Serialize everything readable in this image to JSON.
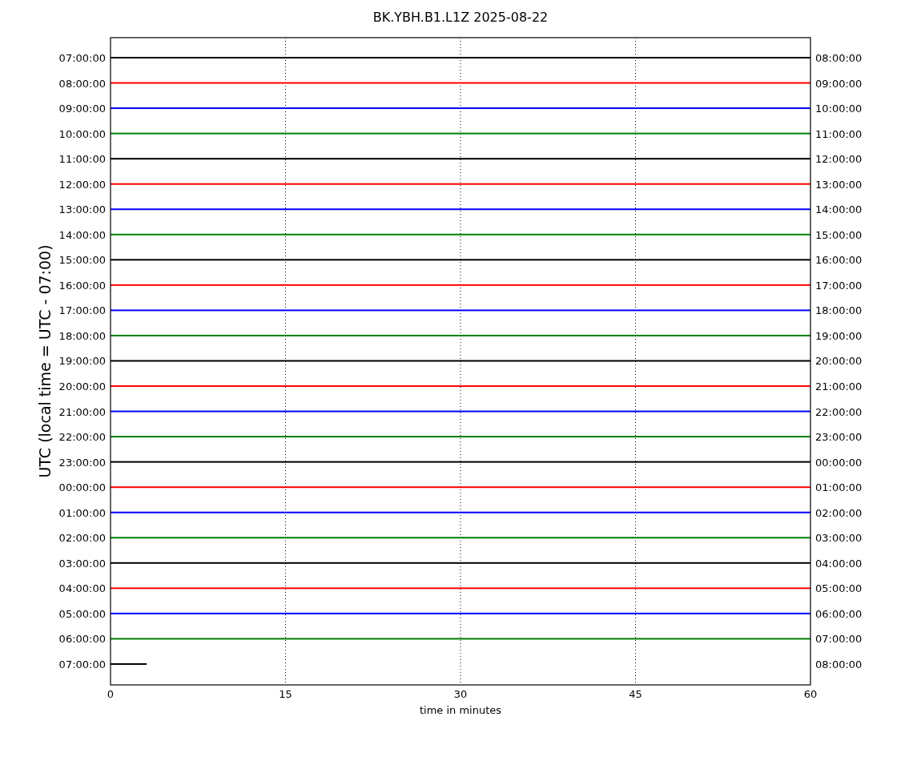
{
  "title": "BK.YBH.B1.L1Z 2025-08-22",
  "y_axis": {
    "label": "UTC (local time = UTC - 07:00)"
  },
  "x_axis": {
    "label": "time in minutes",
    "ticks": [
      "0",
      "15",
      "30",
      "45",
      "60"
    ]
  },
  "traces": [
    {
      "left": "07:00:00",
      "right": "08:00:00",
      "color": "#000000",
      "kind": "full"
    },
    {
      "left": "08:00:00",
      "right": "09:00:00",
      "color": "#ff0000",
      "kind": "full"
    },
    {
      "left": "09:00:00",
      "right": "10:00:00",
      "color": "#0000ff",
      "kind": "full"
    },
    {
      "left": "10:00:00",
      "right": "11:00:00",
      "color": "#008000",
      "kind": "full"
    },
    {
      "left": "11:00:00",
      "right": "12:00:00",
      "color": "#000000",
      "kind": "full"
    },
    {
      "left": "12:00:00",
      "right": "13:00:00",
      "color": "#ff0000",
      "kind": "full"
    },
    {
      "left": "13:00:00",
      "right": "14:00:00",
      "color": "#0000ff",
      "kind": "full"
    },
    {
      "left": "14:00:00",
      "right": "15:00:00",
      "color": "#008000",
      "kind": "full"
    },
    {
      "left": "15:00:00",
      "right": "16:00:00",
      "color": "#000000",
      "kind": "full"
    },
    {
      "left": "16:00:00",
      "right": "17:00:00",
      "color": "#ff0000",
      "kind": "full"
    },
    {
      "left": "17:00:00",
      "right": "18:00:00",
      "color": "#0000ff",
      "kind": "full"
    },
    {
      "left": "18:00:00",
      "right": "19:00:00",
      "color": "#008000",
      "kind": "full"
    },
    {
      "left": "19:00:00",
      "right": "20:00:00",
      "color": "#000000",
      "kind": "full"
    },
    {
      "left": "20:00:00",
      "right": "21:00:00",
      "color": "#ff0000",
      "kind": "full"
    },
    {
      "left": "21:00:00",
      "right": "22:00:00",
      "color": "#0000ff",
      "kind": "full"
    },
    {
      "left": "22:00:00",
      "right": "23:00:00",
      "color": "#008000",
      "kind": "full"
    },
    {
      "left": "23:00:00",
      "right": "00:00:00",
      "color": "#000000",
      "kind": "full"
    },
    {
      "left": "00:00:00",
      "right": "01:00:00",
      "color": "#ff0000",
      "kind": "full"
    },
    {
      "left": "01:00:00",
      "right": "02:00:00",
      "color": "#0000ff",
      "kind": "full"
    },
    {
      "left": "02:00:00",
      "right": "03:00:00",
      "color": "#008000",
      "kind": "full"
    },
    {
      "left": "03:00:00",
      "right": "04:00:00",
      "color": "#000000",
      "kind": "full"
    },
    {
      "left": "04:00:00",
      "right": "05:00:00",
      "color": "#ff0000",
      "kind": "full"
    },
    {
      "left": "05:00:00",
      "right": "06:00:00",
      "color": "#0000ff",
      "kind": "full"
    },
    {
      "left": "06:00:00",
      "right": "07:00:00",
      "color": "#008000",
      "kind": "full"
    },
    {
      "left": "07:00:00",
      "right": "08:00:00",
      "color": "#000000",
      "kind": "partial"
    }
  ]
}
